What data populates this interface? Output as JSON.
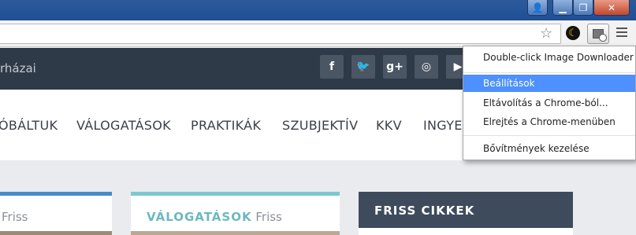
{
  "window": {
    "profile_icon": "person-icon",
    "minimize_icon": "minimize-icon",
    "maximize_icon": "restore-icon",
    "close_icon": "close-icon",
    "minimize_glyph": "▁",
    "maximize_glyph": "❐",
    "close_glyph": "✕",
    "profile_glyph": "👤"
  },
  "toolbar": {
    "star_glyph": "☆"
  },
  "site": {
    "tagline": "rházai",
    "social": {
      "facebook": "f",
      "twitter": "🐦",
      "googleplus": "g+",
      "instagram": "◎",
      "youtube": "▶"
    },
    "nav": [
      "ÓBÁLTUK",
      "VÁLOGATÁSOK",
      "PRAKTIKÁK",
      "SZUBJEKTÍV",
      "KKV",
      "INGYEN"
    ],
    "cards": {
      "card1_light": "Friss",
      "card2_strong": "VÁLOGATÁSOK",
      "card2_light": "Friss",
      "card3_title": "FRISS CIKKEK"
    }
  },
  "context_menu": {
    "items": [
      {
        "label": "Double-click Image Downloader"
      },
      {
        "label": "Beállítások"
      },
      {
        "label": "Eltávolítás a Chrome-ból..."
      },
      {
        "label": "Elrejtés a Chrome-menüben"
      },
      {
        "label": "Bővítmények kezelése"
      }
    ]
  },
  "colors": {
    "header_bg": "#2f3a48",
    "menu_highlight": "#4d90fe",
    "accent_teal": "#6bb8c3",
    "accent_blue": "#4a8ac8"
  }
}
